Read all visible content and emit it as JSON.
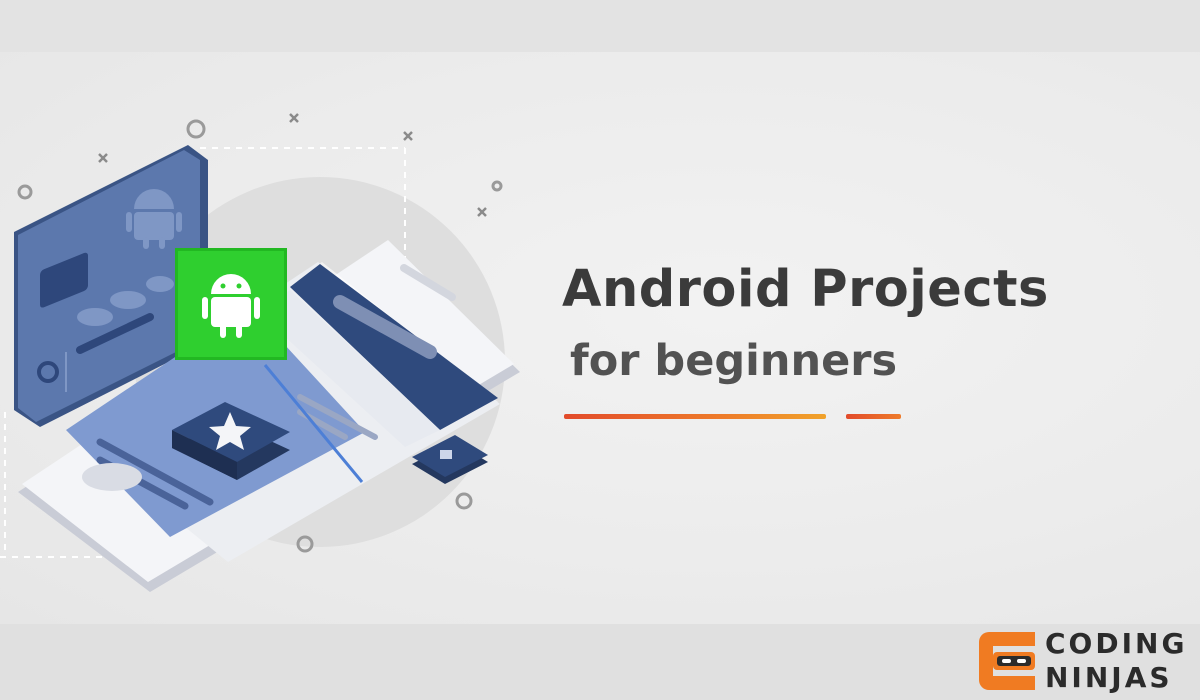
{
  "banner": {
    "title": "Android Projects",
    "subtitle": "for beginners",
    "accent_colors": {
      "red": "#e24b2b",
      "orange": "#ee7b2a",
      "yellow": "#f0a22a"
    }
  },
  "illustration": {
    "phone_color": "#f4f5f8",
    "screen_color": "#5d7fbe",
    "android_badge_color": "#2fcf2f",
    "icons": [
      "android-logo-icon",
      "android-badge-icon",
      "star-icon"
    ]
  },
  "brand": {
    "line1": "CODING",
    "line2": "NINJAS",
    "icon_color": "#f07b22"
  }
}
